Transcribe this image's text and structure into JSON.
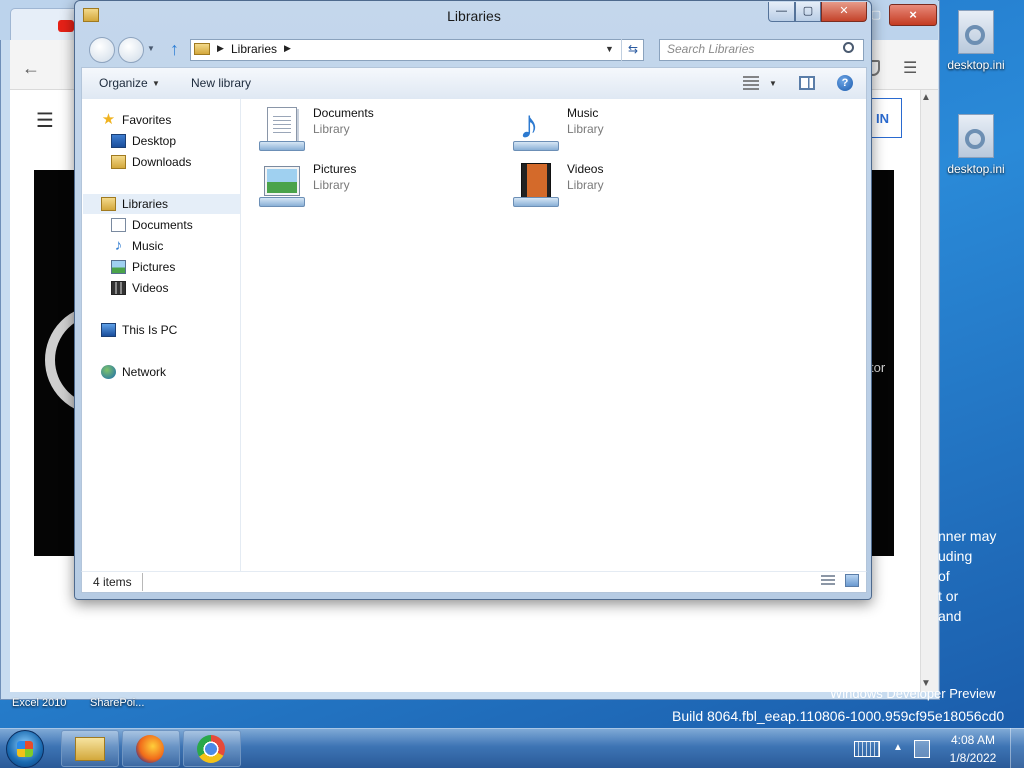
{
  "explorer": {
    "title": "Libraries",
    "address": {
      "crumb": "Libraries"
    },
    "search": {
      "placeholder": "Search Libraries"
    },
    "command_bar": {
      "organize": "Organize",
      "new_library": "New library"
    },
    "nav_tree": {
      "favorites": "Favorites",
      "desktop": "Desktop",
      "downloads": "Downloads",
      "libraries": "Libraries",
      "documents": "Documents",
      "music": "Music",
      "pictures": "Pictures",
      "videos": "Videos",
      "this_pc": "This Is PC",
      "network": "Network"
    },
    "items": [
      {
        "name": "Documents",
        "type": "Library"
      },
      {
        "name": "Music",
        "type": "Library"
      },
      {
        "name": "Pictures",
        "type": "Library"
      },
      {
        "name": "Videos",
        "type": "Library"
      }
    ],
    "status": "4 items"
  },
  "browser": {
    "signin_label": "IN",
    "video_caption": "tor"
  },
  "desktop": {
    "icons": [
      "desktop.ini",
      "desktop.ini"
    ],
    "partial_text": [
      "nner may",
      "uding",
      "of",
      "t or",
      "and"
    ],
    "watermark_line1": "Windows Developer Preview",
    "watermark_line2": "Build 8064.fbl_eeap.110806-1000.959cf95e18056cd0",
    "labels": {
      "excel": "Excel 2010",
      "sharepoint": "SharePoi..."
    }
  },
  "taskbar": {
    "time": "4:08 AM",
    "date": "1/8/2022"
  }
}
